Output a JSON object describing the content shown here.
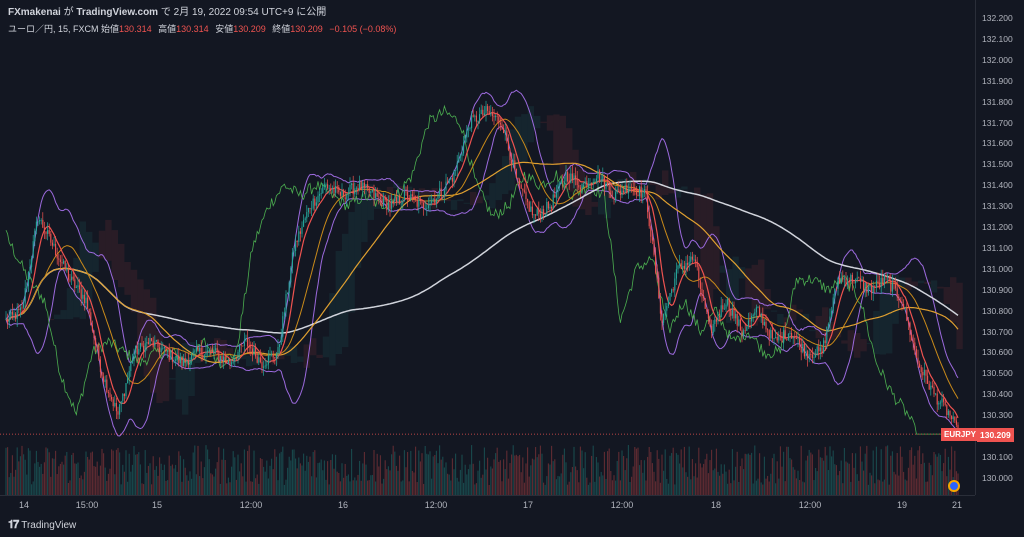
{
  "header": {
    "publisher": "FXmakenai",
    "publish_prefix": "が",
    "site": "TradingView.com",
    "publish_suffix": "で 2月 19, 2022 09:54 UTC+9 に公開",
    "symbol_desc": "ユーロ／円, 15, FXCM",
    "open_label": "始値",
    "open_value": "130.314",
    "high_label": "高値",
    "high_value": "130.314",
    "low_label": "安値",
    "low_value": "130.209",
    "close_label": "終値",
    "close_value": "130.209",
    "change": "−0.105 (−0.08%)"
  },
  "price_axis": {
    "ticks": [
      "132.200",
      "132.100",
      "132.000",
      "131.900",
      "131.800",
      "131.700",
      "131.600",
      "131.500",
      "131.400",
      "131.300",
      "131.200",
      "131.100",
      "131.000",
      "130.900",
      "130.800",
      "130.700",
      "130.600",
      "130.500",
      "130.400",
      "130.300",
      "130.100",
      "130.000"
    ]
  },
  "time_axis": {
    "ticks": [
      "14",
      "15:00",
      "15",
      "12:00",
      "16",
      "12:00",
      "17",
      "12:00",
      "18",
      "12:00",
      "19",
      "21"
    ]
  },
  "last_price": {
    "symbol": "EURJPY",
    "value": "130.209"
  },
  "footer": {
    "brand": "TradingView",
    "logo": "tradingview-logo-icon"
  },
  "colors": {
    "background": "#131722",
    "up": "#26a69a",
    "down": "#ef5350",
    "bollinger": "#9c6ade",
    "ma_long": "#d1d4dc",
    "ma_mid": "#e0a030",
    "ma_fast": "#ef5350",
    "chikou": "#4caf50"
  },
  "chart_data": {
    "type": "candlestick",
    "symbol": "EURJPY",
    "interval": "15",
    "ylim": [
      129.95,
      132.22
    ],
    "x_tick_labels": [
      "14",
      "15:00",
      "15",
      "12:00",
      "16",
      "12:00",
      "17",
      "12:00",
      "18",
      "12:00",
      "19",
      "21"
    ],
    "close_anchors": [
      [
        0,
        130.75
      ],
      [
        10,
        130.8
      ],
      [
        20,
        131.25
      ],
      [
        30,
        131.1
      ],
      [
        40,
        130.95
      ],
      [
        50,
        130.85
      ],
      [
        60,
        130.5
      ],
      [
        70,
        130.3
      ],
      [
        80,
        130.6
      ],
      [
        90,
        130.65
      ],
      [
        100,
        130.6
      ],
      [
        110,
        130.55
      ],
      [
        120,
        130.6
      ],
      [
        130,
        130.6
      ],
      [
        140,
        130.55
      ],
      [
        150,
        130.65
      ],
      [
        160,
        130.55
      ],
      [
        170,
        130.6
      ],
      [
        180,
        131.1
      ],
      [
        190,
        131.3
      ],
      [
        200,
        131.4
      ],
      [
        210,
        131.35
      ],
      [
        220,
        131.4
      ],
      [
        230,
        131.35
      ],
      [
        240,
        131.3
      ],
      [
        250,
        131.35
      ],
      [
        260,
        131.3
      ],
      [
        270,
        131.35
      ],
      [
        280,
        131.45
      ],
      [
        290,
        131.7
      ],
      [
        300,
        131.75
      ],
      [
        310,
        131.7
      ],
      [
        320,
        131.4
      ],
      [
        330,
        131.25
      ],
      [
        340,
        131.3
      ],
      [
        350,
        131.45
      ],
      [
        360,
        131.4
      ],
      [
        370,
        131.45
      ],
      [
        380,
        131.35
      ],
      [
        390,
        131.4
      ],
      [
        400,
        131.35
      ],
      [
        410,
        130.75
      ],
      [
        420,
        131.0
      ],
      [
        430,
        131.05
      ],
      [
        440,
        130.7
      ],
      [
        450,
        130.85
      ],
      [
        460,
        130.7
      ],
      [
        470,
        130.8
      ],
      [
        480,
        130.65
      ],
      [
        490,
        130.7
      ],
      [
        500,
        130.6
      ],
      [
        510,
        130.6
      ],
      [
        520,
        130.95
      ],
      [
        530,
        130.95
      ],
      [
        540,
        130.9
      ],
      [
        550,
        130.95
      ],
      [
        560,
        130.85
      ],
      [
        570,
        130.55
      ],
      [
        580,
        130.4
      ],
      [
        590,
        130.3
      ],
      [
        595,
        130.21
      ]
    ],
    "last_close": 130.209
  }
}
